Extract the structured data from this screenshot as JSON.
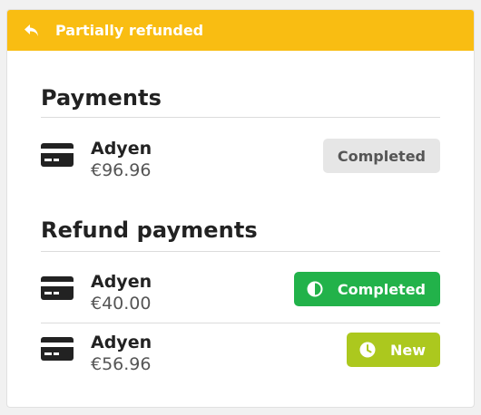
{
  "status_banner": {
    "icon": "reply-arrow-icon",
    "label": "Partially refunded",
    "color": "#f9bd12"
  },
  "payments": {
    "title": "Payments",
    "items": [
      {
        "method": "Adyen",
        "amount": "€96.96",
        "status": "Completed",
        "status_style": "neutral",
        "icon": "credit-card-icon"
      }
    ]
  },
  "refund_payments": {
    "title": "Refund payments",
    "items": [
      {
        "method": "Adyen",
        "amount": "€40.00",
        "status": "Completed",
        "status_style": "success",
        "status_icon": "half-circle-icon",
        "status_color": "#22b24a",
        "icon": "credit-card-icon"
      },
      {
        "method": "Adyen",
        "amount": "€56.96",
        "status": "New",
        "status_style": "new",
        "status_icon": "clock-icon",
        "status_color": "#acc81e",
        "icon": "credit-card-icon"
      }
    ]
  }
}
